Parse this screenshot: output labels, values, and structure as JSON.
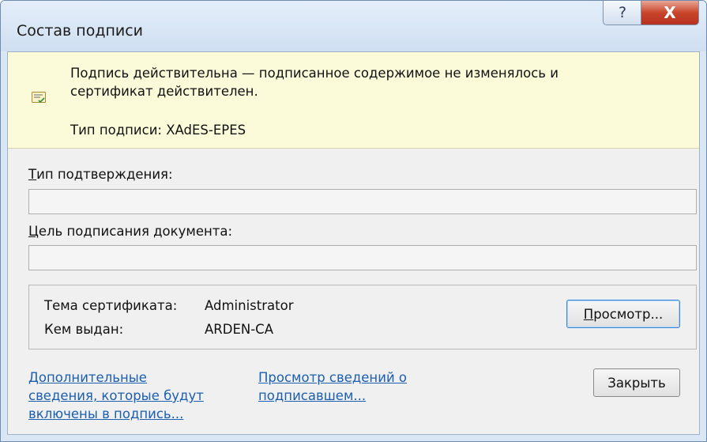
{
  "window": {
    "title": "Состав подписи",
    "help_glyph": "?",
    "close_glyph": "X"
  },
  "banner": {
    "icon": "signature-valid-icon",
    "message_line1": "Подпись действительна — подписанное содержимое не изменялось и",
    "message_line2": "сертификат действителен.",
    "sigtype": "Тип подписи: XAdES-EPES"
  },
  "commitment": {
    "label_key": "Т",
    "label_rest": "ип подтверждения:",
    "value": ""
  },
  "purpose": {
    "label_key": "Ц",
    "label_rest": "ель подписания документа:",
    "value": ""
  },
  "certificate": {
    "subject_label": "Тема сертификата:",
    "subject_value": "Administrator",
    "issuer_label": "Кем выдан:",
    "issuer_value": "ARDEN-CA",
    "view_button_key": "П",
    "view_button_rest": "росмотр..."
  },
  "links": {
    "additional_line1": "Дополнительные",
    "additional_line2": "сведения, которые будут",
    "additional_line3": "включены в подпись...",
    "signer_line1": "Просмотр сведений о",
    "signer_line2": "подписавшем..."
  },
  "footer": {
    "close_label": "Закрыть"
  },
  "colors": {
    "banner_bg": "#fbfbd9",
    "link": "#1c5fae",
    "close_button_red": "#c9452b"
  }
}
